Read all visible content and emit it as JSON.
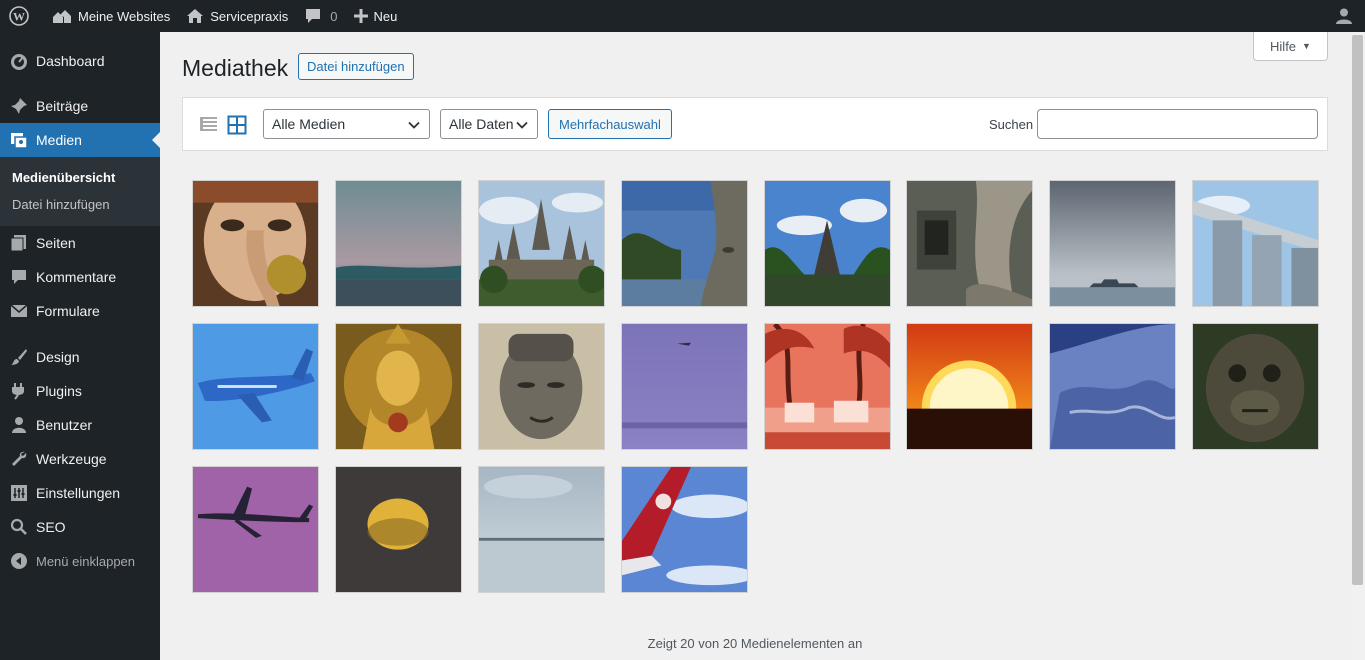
{
  "adminbar": {
    "my_sites": "Meine Websites",
    "site_name": "Servicepraxis",
    "comments_count": "0",
    "new_label": "Neu"
  },
  "sidebar": {
    "items": [
      {
        "label": "Dashboard",
        "icon": "dashboard-icon"
      },
      {
        "label": "Beiträge",
        "icon": "pin-icon"
      },
      {
        "label": "Medien",
        "icon": "media-icon"
      },
      {
        "label": "Seiten",
        "icon": "pages-icon"
      },
      {
        "label": "Kommentare",
        "icon": "comment-icon"
      },
      {
        "label": "Formulare",
        "icon": "mail-icon"
      },
      {
        "label": "Design",
        "icon": "brush-icon"
      },
      {
        "label": "Plugins",
        "icon": "plugin-icon"
      },
      {
        "label": "Benutzer",
        "icon": "user-icon"
      },
      {
        "label": "Werkzeuge",
        "icon": "wrench-icon"
      },
      {
        "label": "Einstellungen",
        "icon": "settings-icon"
      },
      {
        "label": "SEO",
        "icon": "search-icon"
      }
    ],
    "submenu": [
      "Medienübersicht",
      "Datei hinzufügen"
    ],
    "collapse": "Menü einklappen"
  },
  "main": {
    "help": "Hilfe",
    "title": "Mediathek",
    "add_file": "Datei hinzufügen",
    "filter_media": "Alle Medien",
    "filter_dates": "Alle Daten",
    "multi_select": "Mehrfachauswahl",
    "search_label": "Suchen",
    "search_value": "",
    "count_text": "Zeigt 20 von 20 Medienelementen an"
  },
  "colors": {
    "adminbar_bg": "#1d2327",
    "accent": "#2271b1",
    "page_bg": "#f0f0f1"
  },
  "thumbnails": [
    "ganesha-statue",
    "sea-dusk",
    "angkor-wat",
    "stone-face-river",
    "temple-palms",
    "ruins-tree",
    "ship-sea",
    "marina-bay-sands",
    "airplane-blue-sky",
    "golden-buddha",
    "stone-buddha-face",
    "purple-sky-plane",
    "red-palms-beach",
    "orange-sunset",
    "earth-from-space",
    "monkey-statue",
    "plane-purple-sky",
    "sunset-sun",
    "calm-lake",
    "airplane-wing"
  ]
}
